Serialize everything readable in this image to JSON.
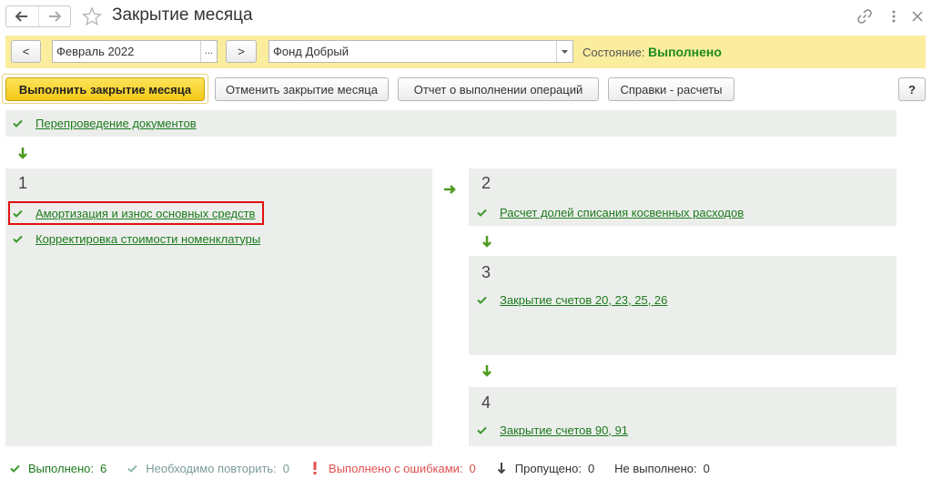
{
  "window": {
    "title": "Закрытие месяца",
    "icons": [
      "back-icon",
      "forward-icon",
      "star-icon",
      "link-icon",
      "more-icon",
      "close-icon"
    ]
  },
  "period": {
    "prev_label": "<",
    "next_label": ">",
    "month_value": "Февраль 2022",
    "month_picker_label": "...",
    "organization_value": "Фонд Добрый",
    "state_label": "Состояние:",
    "state_value": "Выполнено"
  },
  "actions": {
    "run_label": "Выполнить закрытие месяца",
    "cancel_label": "Отменить закрытие месяца",
    "report_label": "Отчет о выполнении операций",
    "reference_label": "Справки - расчеты",
    "help_label": "?"
  },
  "stages": {
    "repost": {
      "label": "Перепроведение документов"
    },
    "stage1": {
      "number": "1",
      "operations": [
        "Амортизация и износ основных средств",
        "Корректировка стоимости номенклатуры"
      ]
    },
    "stage2": {
      "number": "2",
      "operations": [
        "Расчет долей списания косвенных расходов"
      ]
    },
    "stage3": {
      "number": "3",
      "operations": [
        "Закрытие счетов 20, 23, 25, 26"
      ]
    },
    "stage4": {
      "number": "4",
      "operations": [
        "Закрытие счетов 90, 91"
      ]
    }
  },
  "footer": {
    "done_label": "Выполнено:",
    "done_count": "6",
    "repeat_label": "Необходимо повторить:",
    "repeat_count": "0",
    "errors_label": "Выполнено с ошибками:",
    "errors_count": "0",
    "skipped_label": "Пропущено:",
    "skipped_count": "0",
    "notdone_label": "Не выполнено:",
    "notdone_count": "0"
  },
  "colors": {
    "accent_yellow": "#fbed9e",
    "success_green": "#1e8a1e",
    "link_green": "#1c7a1c",
    "panel_gray": "#eceeec",
    "error_red": "#e05050",
    "highlight_red": "#e01010"
  }
}
